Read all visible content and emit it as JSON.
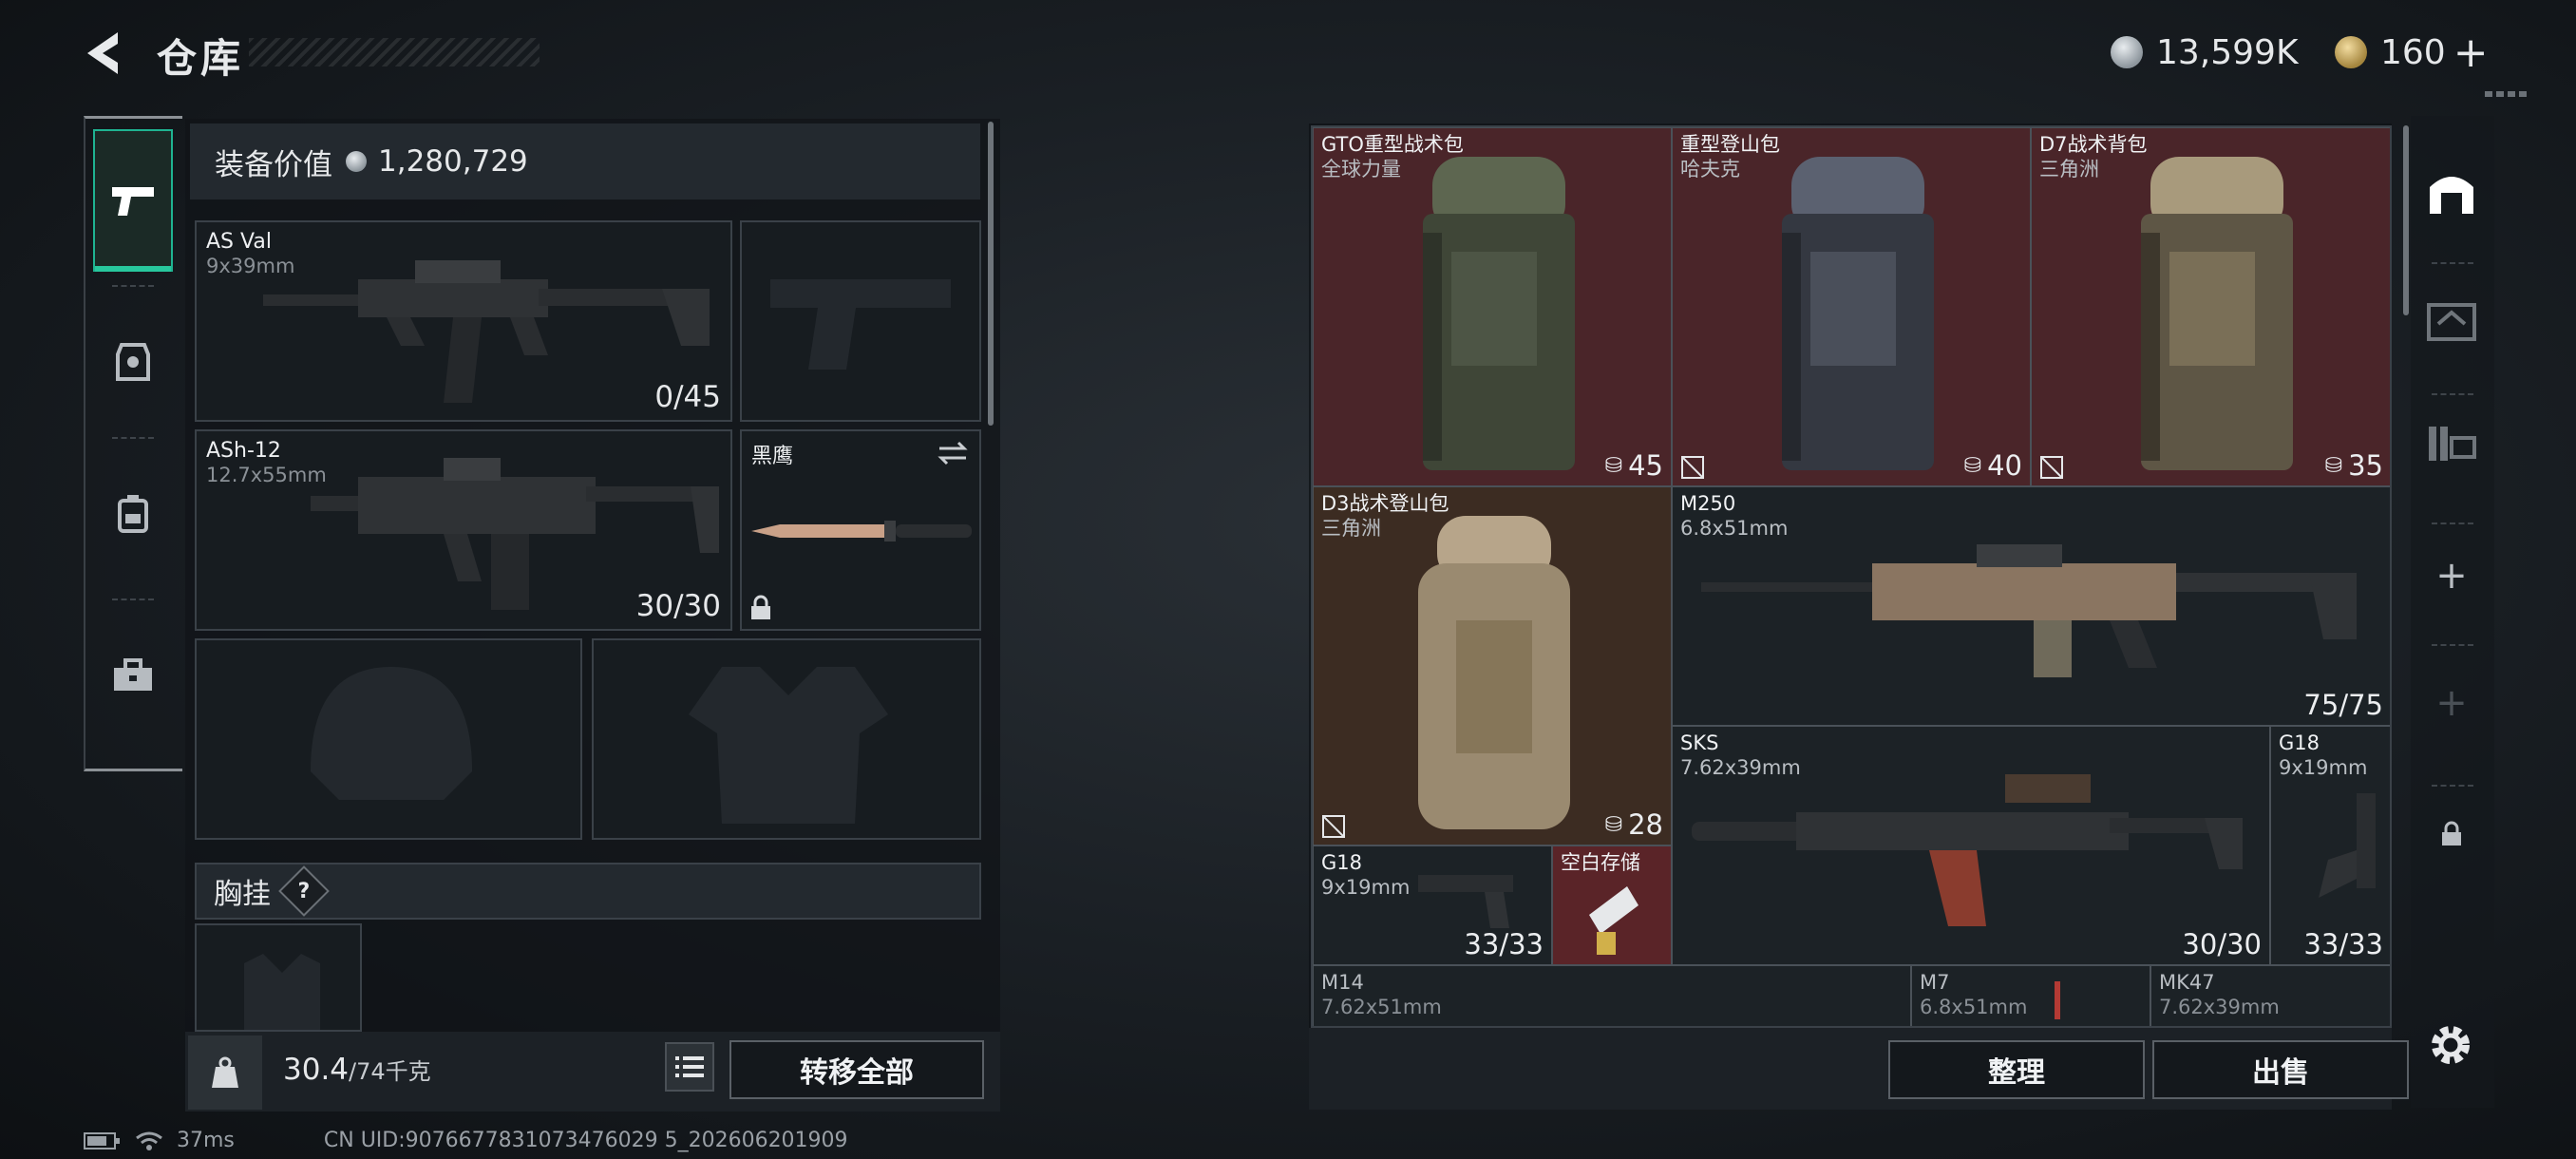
{
  "header": {
    "title": "仓库",
    "currency_silver": "13,599K",
    "currency_gold": "160"
  },
  "nav": {
    "items": [
      "weapons",
      "armor",
      "backpack",
      "toolkit"
    ]
  },
  "loadout": {
    "value_label": "装备价值",
    "value": "1,280,729",
    "primary": {
      "name": "AS Val",
      "caliber": "9x39mm",
      "ammo": "0/45"
    },
    "secondary": {
      "name": "ASh-12",
      "caliber": "12.7x55mm",
      "ammo": "30/30"
    },
    "melee": {
      "name": "黑鹰"
    },
    "chest_label": "胸挂",
    "help": "?",
    "weight": "30.4",
    "weight_max": "/74千克",
    "transfer_all": "转移全部"
  },
  "stash": {
    "items": [
      {
        "name": "GTO重型战术包",
        "sub": "全球力量",
        "count": "45"
      },
      {
        "name": "重型登山包",
        "sub": "哈夫克",
        "count": "40"
      },
      {
        "name": "D7战术背包",
        "sub": "三角洲",
        "count": "35"
      },
      {
        "name": "D3战术登山包",
        "sub": "三角洲",
        "count": "28"
      },
      {
        "name": "M250",
        "sub": "6.8x51mm",
        "count": "75/75"
      },
      {
        "name": "SKS",
        "sub": "7.62x39mm",
        "count": "30/30"
      },
      {
        "name": "G18",
        "sub": "9x19mm",
        "count": "33/33"
      },
      {
        "name": "G18",
        "sub": "9x19mm",
        "count": "33/33"
      },
      {
        "name": "空白存储",
        "sub": "",
        "count": ""
      },
      {
        "name": "M14",
        "sub": "7.62x51mm",
        "count": ""
      },
      {
        "name": "M7",
        "sub": "6.8x51mm",
        "count": ""
      },
      {
        "name": "MK47",
        "sub": "7.62x39mm",
        "count": ""
      }
    ],
    "sort": "整理",
    "sell": "出售"
  },
  "status": {
    "ping": "37ms",
    "uid": "CN UID:9076677831073476029 5_202606201909"
  }
}
